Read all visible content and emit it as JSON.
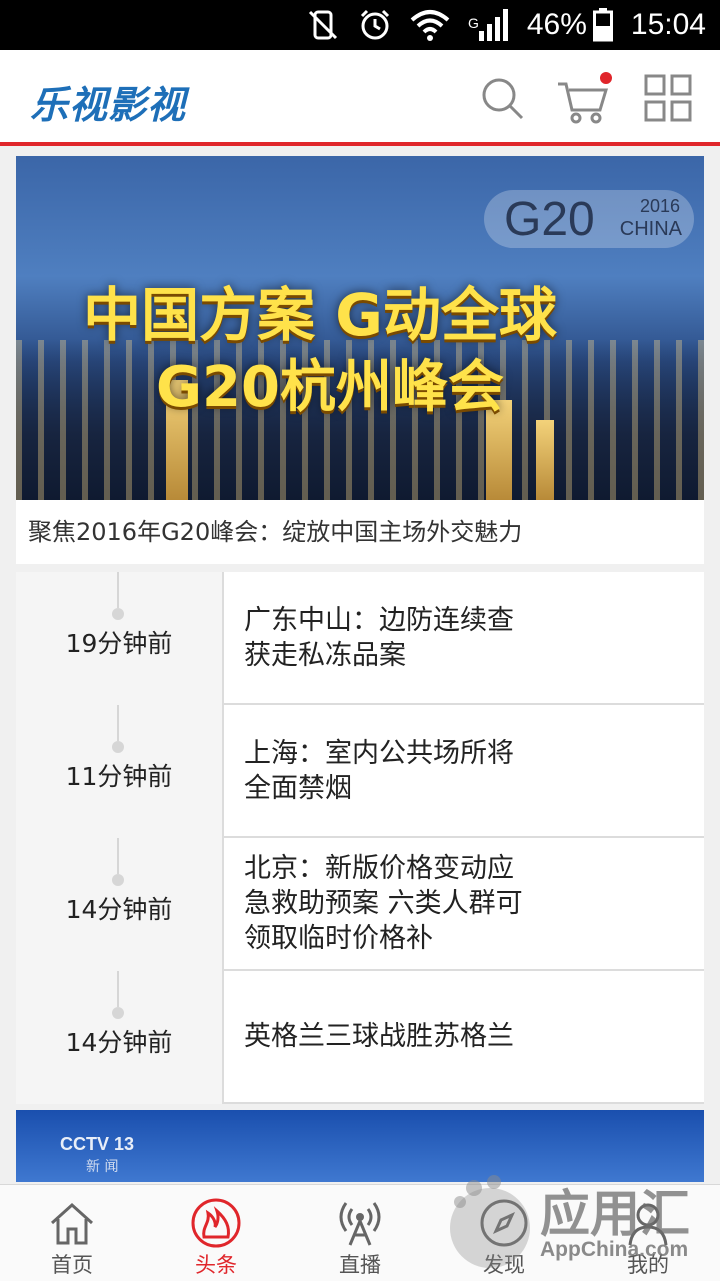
{
  "status_bar": {
    "battery": "46%",
    "time": "15:04",
    "signal_label": "G",
    "icons": [
      "no-sim-vibrate-icon",
      "alarm-icon",
      "wifi-icon",
      "signal-icon",
      "battery-icon"
    ]
  },
  "header": {
    "logo": "乐视影视",
    "icons": [
      "search-icon",
      "cart-icon",
      "grid-menu-icon"
    ],
    "accent": "#e0262b",
    "brand_color": "#1e6fb8"
  },
  "banner": {
    "headline_line1": "中国方案 G动全球",
    "headline_line2": "G20杭州峰会",
    "logo_main": "G20",
    "logo_year": "2016",
    "logo_country": "CHINA",
    "caption": "聚焦2016年G20峰会：绽放中国主场外交魅力"
  },
  "news": [
    {
      "time": "19分钟前",
      "title": "广东中山：边防连续查获走私冻品案"
    },
    {
      "time": "11分钟前",
      "title": "上海：室内公共场所将全面禁烟"
    },
    {
      "time": "14分钟前",
      "title": "北京：新版价格变动应急救助预案 六类人群可领取临时价格补"
    },
    {
      "time": "14分钟前",
      "title": "英格兰三球战胜苏格兰"
    }
  ],
  "banner2": {
    "channel": "CCTV 13",
    "channel_sub": "新 闻"
  },
  "tabs": [
    {
      "label": "首页",
      "icon": "home-icon",
      "active": false
    },
    {
      "label": "头条",
      "icon": "flame-icon",
      "active": true
    },
    {
      "label": "直播",
      "icon": "broadcast-icon",
      "active": false
    },
    {
      "label": "发现",
      "icon": "compass-icon",
      "active": false
    },
    {
      "label": "我的",
      "icon": "user-icon",
      "active": false
    }
  ],
  "watermark": {
    "text": "应用汇",
    "sub": "AppChina.com"
  }
}
